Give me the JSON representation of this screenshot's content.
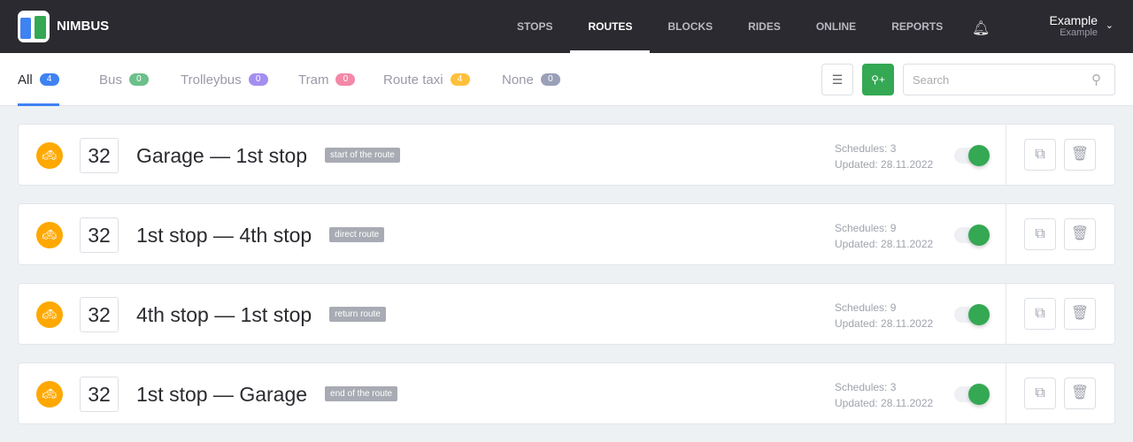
{
  "header": {
    "brand": "NIMBUS",
    "nav": [
      "STOPS",
      "ROUTES",
      "BLOCKS",
      "RIDES",
      "ONLINE",
      "REPORTS"
    ],
    "active_nav": "ROUTES",
    "user_name": "Example",
    "user_sub": "Example"
  },
  "tabs": [
    {
      "label": "All",
      "count": "4",
      "color": "#3f82f1"
    },
    {
      "label": "Bus",
      "count": "0",
      "color": "#6cc08a"
    },
    {
      "label": "Trolleybus",
      "count": "0",
      "color": "#a48ef0"
    },
    {
      "label": "Tram",
      "count": "0",
      "color": "#f388a8"
    },
    {
      "label": "Route taxi",
      "count": "4",
      "color": "#ffc13b"
    },
    {
      "label": "None",
      "count": "0",
      "color": "#9aa0b8"
    }
  ],
  "search": {
    "placeholder": "Search"
  },
  "routes": [
    {
      "number": "32",
      "title": "Garage — 1st stop",
      "tag": "start of the route",
      "schedules": "Schedules: 3",
      "updated": "Updated: 28.11.2022"
    },
    {
      "number": "32",
      "title": "1st stop — 4th stop",
      "tag": "direct route",
      "schedules": "Schedules: 9",
      "updated": "Updated: 28.11.2022"
    },
    {
      "number": "32",
      "title": "4th stop — 1st stop",
      "tag": "return route",
      "schedules": "Schedules: 9",
      "updated": "Updated: 28.11.2022"
    },
    {
      "number": "32",
      "title": "1st stop — Garage",
      "tag": "end of the route",
      "schedules": "Schedules: 3",
      "updated": "Updated: 28.11.2022"
    }
  ]
}
